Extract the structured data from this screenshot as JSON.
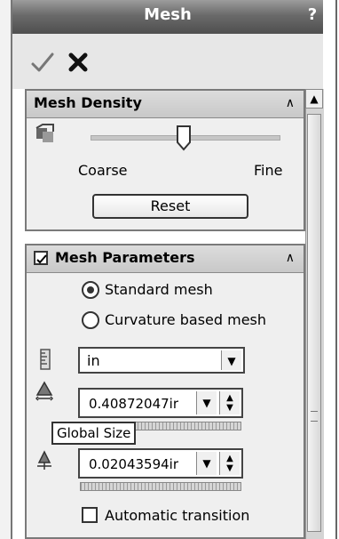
{
  "title": "Mesh",
  "help_label": "?",
  "actions": {
    "ok_icon": "check-icon",
    "cancel_icon": "x-icon"
  },
  "mesh_density": {
    "title": "Mesh Density",
    "slider_value": 0.5,
    "left_label": "Coarse",
    "right_label": "Fine",
    "reset_label": "Reset"
  },
  "mesh_parameters": {
    "title": "Mesh Parameters",
    "checked": true,
    "options": [
      {
        "label": "Standard mesh",
        "selected": true
      },
      {
        "label": "Curvature based mesh",
        "selected": false
      }
    ],
    "unit": "in",
    "global_size": "0.40872047ir",
    "tolerance": "0.02043594ir",
    "tooltip": "Global Size",
    "automatic_transition": "Automatic transition"
  }
}
